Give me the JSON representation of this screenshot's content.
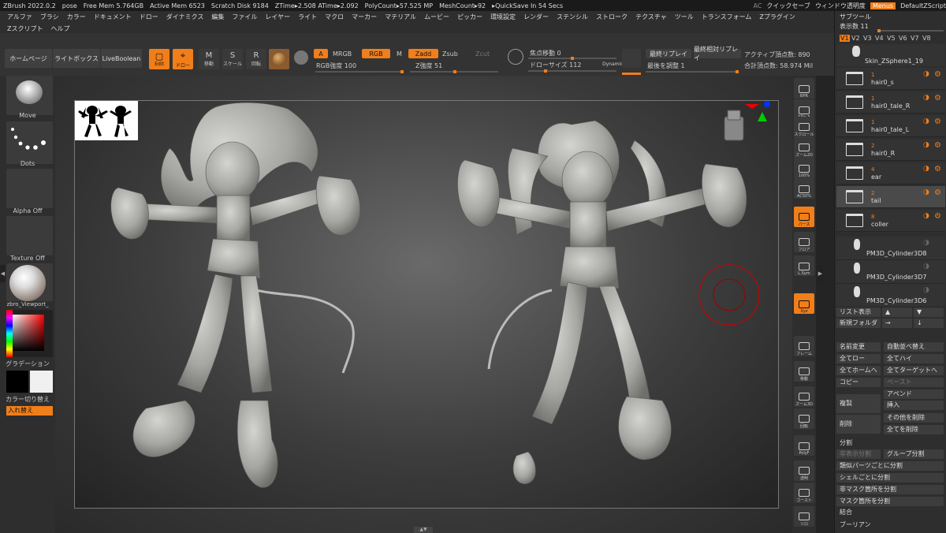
{
  "titlebar": {
    "app": "ZBrush 2022.0.2",
    "doc": "pose",
    "free_mem": "Free Mem 5.764GB",
    "active_mem": "Active Mem 6523",
    "scratch": "Scratch Disk 9184",
    "ztime": "ZTime▸2.508 ATime▸2.092",
    "polycount": "PolyCount▸57.525 MP",
    "meshcount": "MeshCount▸92",
    "quicksave": "▸QuickSave In 54 Secs",
    "ac": "AC",
    "quick_save": "クイックセーブ",
    "window_transp": "ウィンドウ透明度",
    "menus": "Menus",
    "script": "DefaultZScript"
  },
  "menu": [
    "アルファ",
    "ブラシ",
    "カラー",
    "ドキュメント",
    "ドロー",
    "ダイナミクス",
    "編集",
    "ファイル",
    "レイヤー",
    "ライト",
    "マクロ",
    "マーカー",
    "マテリアル",
    "ムービー",
    "ピッカー",
    "環境設定",
    "レンダー",
    "ステンシル",
    "ストローク",
    "テクスチャ",
    "ツール",
    "トランスフォーム",
    "Zプラグイン",
    "Zスクリプト",
    "ヘルプ"
  ],
  "toolbar": {
    "home": "ホームページ",
    "lightbox": "ライトボックス",
    "liveboolean": "LiveBoolean",
    "edit": "Edit",
    "draw": "ドロー",
    "move": "移動",
    "scale": "スケール",
    "rotate": "回転",
    "a": "A",
    "mrgb": "MRGB",
    "rgb": "RGB",
    "m": "M",
    "zadd": "Zadd",
    "zsub": "Zsub",
    "zcut": "Zcut",
    "rgb_intensity": "RGB強度 100",
    "z_intensity": "Z強度 51",
    "focal_shift": "焦点移動 0",
    "draw_size": "ドローサイズ 112",
    "dynamic": "Dynamic",
    "replay_last": "最終リプレイ",
    "replay_last_rel": "最終相対リプレイ",
    "adjust_last": "最後を調整 1",
    "active_points": "アクティブ頂点数: 890",
    "total_points": "合計頂点数: 58.974 Mil",
    "rgb_intensity_value": 100,
    "z_intensity_value": 51,
    "draw_size_value": 112
  },
  "left": {
    "move": "Move",
    "dots": "Dots",
    "alpha": "Alpha Off",
    "texture": "Texture Off",
    "material": "zbro_Viewport_",
    "gradation": "グラデーション",
    "color_switch": "カラー切り替え",
    "swap": "入れ替え"
  },
  "righttools": [
    {
      "name": "bpr",
      "label": "BPR"
    },
    {
      "name": "spix",
      "label": "SPix 3"
    },
    {
      "name": "scroll",
      "label": "スクロール"
    },
    {
      "name": "zoom2d",
      "label": "ズーム2D"
    },
    {
      "name": "100",
      "label": "100%"
    },
    {
      "name": "ac50",
      "label": "AC50%"
    },
    {
      "name": "dynamic-persp",
      "label": "パース"
    },
    {
      "name": "floor",
      "label": "フロア"
    },
    {
      "name": "local",
      "label": "L.Sym"
    },
    {
      "name": "xyz",
      "label": "Xyz"
    },
    {
      "name": "frame",
      "label": "フレーム"
    },
    {
      "name": "move",
      "label": "移動"
    },
    {
      "name": "zoom3d",
      "label": "ズーム3D"
    },
    {
      "name": "rotate",
      "label": "回転"
    },
    {
      "name": "polyf",
      "label": "PolyF"
    },
    {
      "name": "transp",
      "label": "透明"
    },
    {
      "name": "ghost",
      "label": "ゴースト"
    },
    {
      "name": "solo",
      "label": "ソロ"
    }
  ],
  "subtool": {
    "header": "サブツール",
    "display_count": "表示数 11",
    "versions": [
      "V1",
      "V2",
      "V3",
      "V4",
      "V5",
      "V6",
      "V7",
      "V8"
    ],
    "top_item": "Skin_ZSphere1_19",
    "items": [
      {
        "num": "1",
        "name": "hair0_s"
      },
      {
        "num": "1",
        "name": "hair0_tale_R"
      },
      {
        "num": "1",
        "name": "hair0_tale_L"
      },
      {
        "num": "2",
        "name": "hair0_R"
      },
      {
        "num": "4",
        "name": "ear"
      },
      {
        "num": "2",
        "name": "tail"
      },
      {
        "num": "8",
        "name": "coller"
      }
    ],
    "cylinders": [
      "PM3D_Cylinder3D8",
      "PM3D_Cylinder3D7",
      "PM3D_Cylinder3D6"
    ],
    "list_view": "リスト表示",
    "new_folder": "新規フォルダ",
    "rename": "名前変更",
    "auto_sort": "自動並べ替え",
    "all_low": "全てロー",
    "all_high": "全てハイ",
    "all_home": "全てホームへ",
    "all_target": "全てターゲットへ",
    "copy": "コピー",
    "paste": "ペースト",
    "append": "アペンド",
    "duplicate": "複製",
    "insert": "挿入",
    "delete": "削除",
    "delete_other": "その他を削除",
    "delete_all": "全てを削除",
    "split_header": "分割",
    "split_hidden": "非表示分割",
    "group_split": "グループ分割",
    "split_similar": "類似パーツごとに分割",
    "split_shell": "シェルごとに分割",
    "split_unmasked": "非マスク箇所を分割",
    "split_masked": "マスク箇所を分割",
    "merge": "結合",
    "boolean": "ブーリアン"
  },
  "colors": {
    "accent": "#f07e1a",
    "panel": "#2e2e2e",
    "button": "#404040"
  }
}
